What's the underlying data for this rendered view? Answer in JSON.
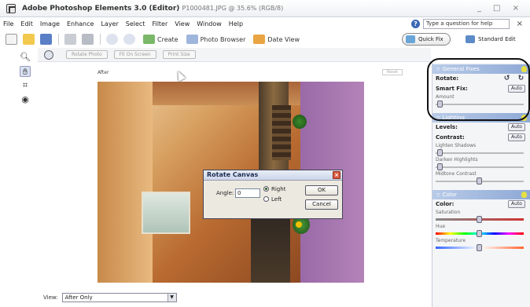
{
  "window": {
    "title": "Adobe Photoshop Elements 3.0 (Editor)",
    "subtitle": "P1000481.JPG @ 35.6% (RGB/8)",
    "controls": "_ □ ×"
  },
  "menu": {
    "items": [
      "File",
      "Edit",
      "Image",
      "Enhance",
      "Layer",
      "Select",
      "Filter",
      "View",
      "Window",
      "Help"
    ],
    "help_placeholder": "Type a question for help",
    "close": "×"
  },
  "toolbar": {
    "create_label": "Create",
    "photo_browser_label": "Photo Browser",
    "date_view_label": "Date View",
    "quick_fix_label": "Quick Fix",
    "standard_edit_label": "Standard Edit"
  },
  "options_bar": {
    "buttons": [
      "Rotate Photo",
      "Fit On Screen",
      "Print Size"
    ]
  },
  "document": {
    "view_header": "After",
    "header_tag": "Reset"
  },
  "dialog": {
    "title": "Rotate Canvas",
    "angle_label": "Angle:",
    "angle_value": "0",
    "right_label": "Right",
    "left_label": "Left",
    "ok_label": "OK",
    "cancel_label": "Cancel",
    "selected_direction": "Right"
  },
  "view_select": {
    "label": "View:",
    "value": "After Only"
  },
  "palette": {
    "general_fixes": {
      "title": "General Fixes",
      "rotate_label": "Rotate:",
      "smart_fix_label": "Smart Fix:",
      "auto_label": "Auto",
      "amount_label": "Amount",
      "amount_level": 0.05
    },
    "lighting": {
      "title": "Lighting",
      "levels_label": "Levels:",
      "contrast_label": "Contrast:",
      "auto_label": "Auto",
      "lighten_shadows_label": "Lighten Shadows",
      "lighten_shadows_level": 0.05,
      "darken_highlights_label": "Darken Highlights",
      "darken_highlights_level": 0.05,
      "midtone_contrast_label": "Midtone Contrast",
      "midtone_contrast_level": 0.5
    },
    "color": {
      "title": "Color",
      "color_label": "Color:",
      "auto_label": "Auto",
      "saturation_label": "Saturation",
      "saturation_level": 0.5,
      "hue_label": "Hue",
      "hue_level": 0.5,
      "temperature_label": "Temperature",
      "temperature_level": 0.5
    }
  },
  "colors": {
    "panel_header": "#8fa9d6",
    "help_icon": "#3a66b5",
    "dialog_title": "#1b2a50"
  }
}
